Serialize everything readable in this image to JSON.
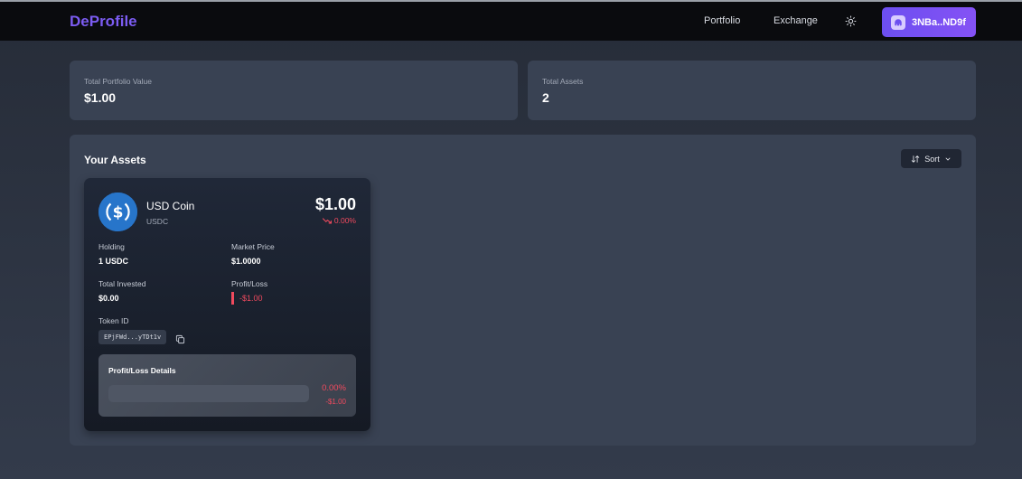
{
  "app": {
    "brand": "DeProfile"
  },
  "nav": {
    "links": [
      "Portfolio",
      "Exchange"
    ],
    "theme_icon": "sun-icon",
    "wallet_address": "3NBa..ND9f",
    "wallet_icon": "wallet-icon"
  },
  "stats": {
    "total_value_label": "Total Portfolio Value",
    "total_value": "$1.00",
    "total_assets_label": "Total Assets",
    "total_assets": "2"
  },
  "assets": {
    "title": "Your Assets",
    "sort_label": "Sort",
    "cards": [
      {
        "name": "USD Coin",
        "symbol": "USDC",
        "price": "$1.00",
        "change": "0.00%",
        "holding_label": "Holding",
        "holding": "1 USDC",
        "market_price_label": "Market Price",
        "market_price": "$1.0000",
        "total_invested_label": "Total Invested",
        "total_invested": "$0.00",
        "profit_loss_label": "Profit/Loss",
        "profit_loss": "-$1.00",
        "token_id_label": "Token ID",
        "token_id": "EPjFWd...yTDt1v",
        "details_title": "Profit/Loss Details",
        "details_pct": "0.00%",
        "details_amount": "-$1.00"
      }
    ]
  },
  "colors": {
    "brand": "#7c5cf2",
    "accent": "#7b55f4",
    "negative": "#f04a5e",
    "usdc": "#2775ca"
  }
}
